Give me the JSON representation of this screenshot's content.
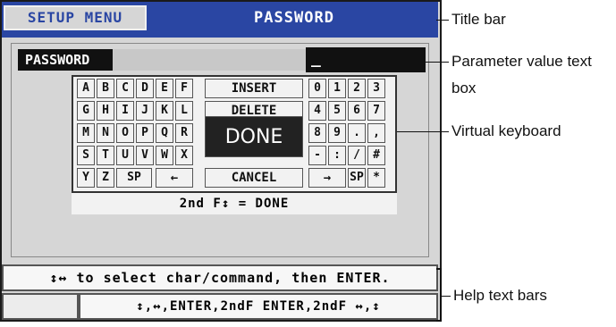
{
  "screen": {
    "menu_tab": "SETUP MENU",
    "title": "PASSWORD",
    "password_label": "PASSWORD",
    "password_value": "_",
    "keyboard": {
      "letter_rows": [
        [
          "A",
          "B",
          "C",
          "D",
          "E",
          "F"
        ],
        [
          "G",
          "H",
          "I",
          "J",
          "K",
          "L"
        ],
        [
          "M",
          "N",
          "O",
          "P",
          "Q",
          "R"
        ],
        [
          "S",
          "T",
          "U",
          "V",
          "W",
          "X"
        ],
        [
          "Y",
          "Z",
          "SP",
          "←"
        ]
      ],
      "commands": {
        "insert": "INSERT",
        "delete": "DELETE",
        "done": "DONE",
        "right_arrow": "→",
        "cancel": "CANCEL"
      },
      "symbol_rows": [
        [
          "0",
          "1",
          "2",
          "3"
        ],
        [
          "4",
          "5",
          "6",
          "7"
        ],
        [
          "8",
          "9",
          ".",
          ","
        ],
        [
          "-",
          ":",
          "/",
          "#"
        ],
        [
          "SP",
          "*"
        ]
      ],
      "hint": "2nd F↕ = DONE"
    },
    "help_line_1": "↕↔ to select char/command, then ENTER.",
    "help_line_2": "↕,↔,ENTER,2ndF ENTER,2ndF ↔,↕"
  },
  "callouts": {
    "title_bar": "Title bar",
    "parameter_line1": "Parameter value text",
    "parameter_line2": "box",
    "virtual_keyboard": "Virtual keyboard",
    "help_text_bars": "Help text bars"
  },
  "colors": {
    "title_bar_bg": "#2a46a3",
    "screen_bg": "#d6d6d6",
    "done_key_bg": "#222222"
  }
}
